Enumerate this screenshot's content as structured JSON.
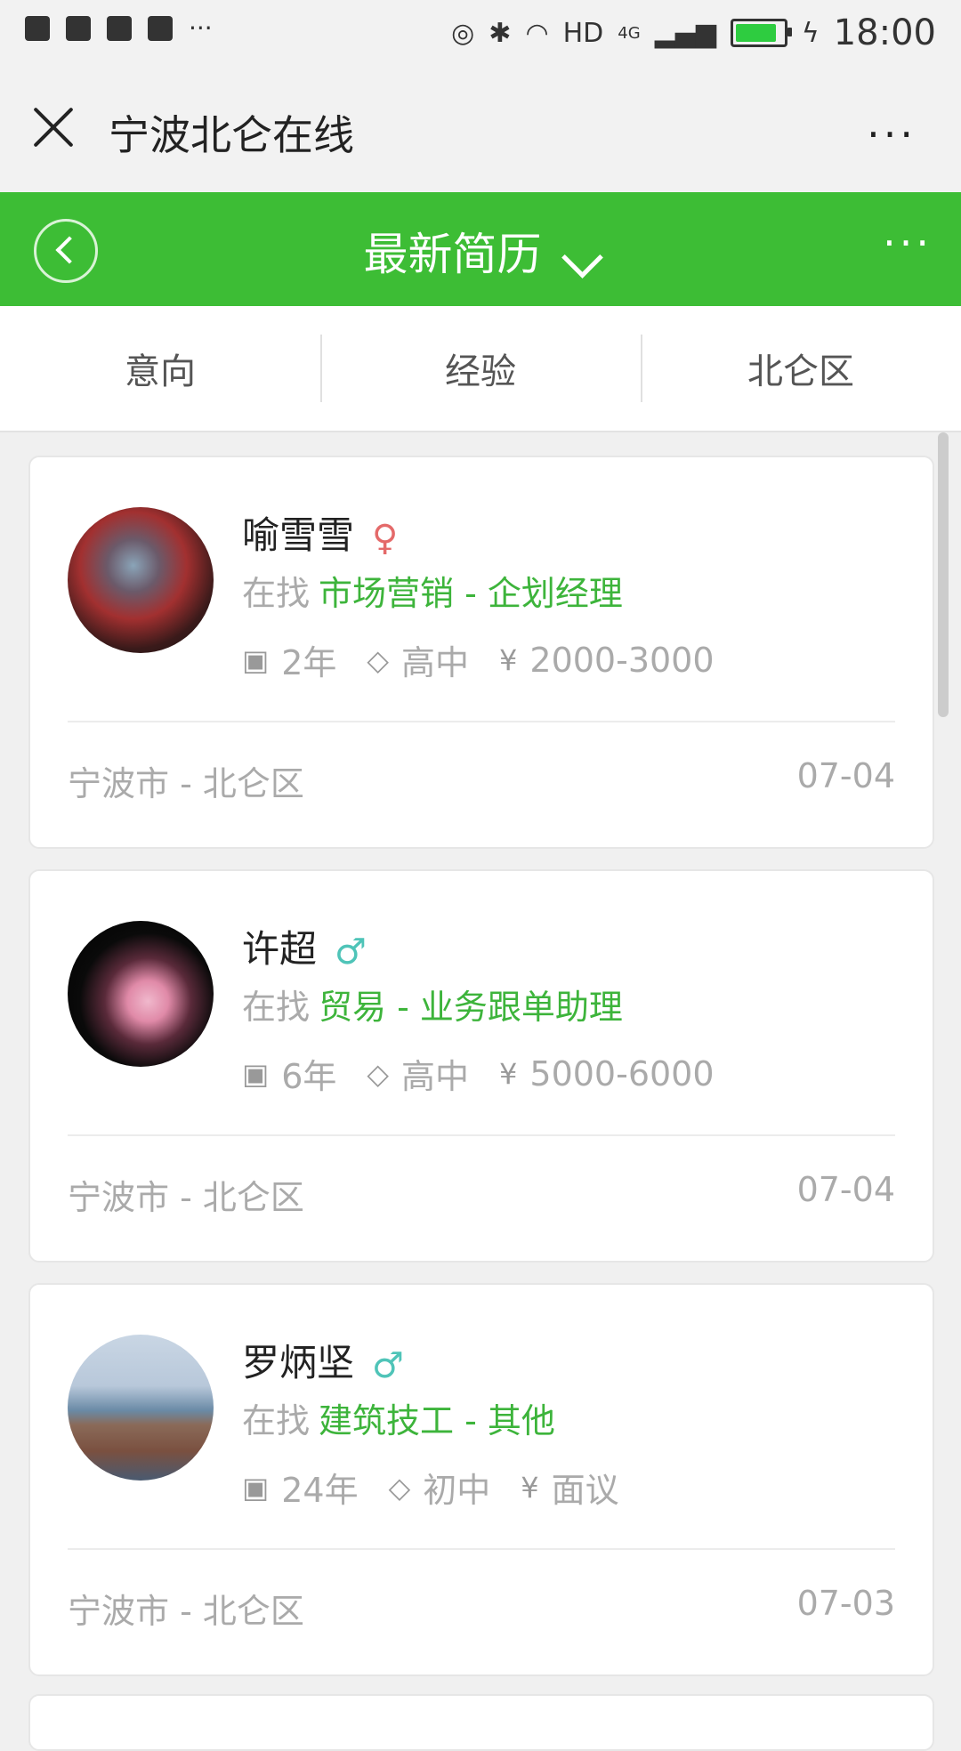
{
  "status_bar": {
    "network": "HD",
    "signal": "4G",
    "time": "18:00"
  },
  "titlebar": {
    "title": "宁波北仑在线",
    "more": "···"
  },
  "header": {
    "title": "最新简历",
    "more": "···"
  },
  "filters": [
    "意向",
    "经验",
    "北仑区"
  ],
  "colors": {
    "brand_green": "#3dbd35",
    "job_green": "#3db43b"
  },
  "resumes": [
    {
      "name": "喻雪雪",
      "gender": "female",
      "gender_symbol": "♀",
      "gender_color": "#e46a6a",
      "seek_label": "在找",
      "job": "市场营销 - 企划经理",
      "experience": "2年",
      "education": "高中",
      "currency": "¥",
      "salary": "2000-3000",
      "location": "宁波市 - 北仑区",
      "date": "07-04"
    },
    {
      "name": "许超",
      "gender": "male",
      "gender_symbol": "♂",
      "gender_color": "#4fc4b8",
      "seek_label": "在找",
      "job": "贸易 - 业务跟单助理",
      "experience": "6年",
      "education": "高中",
      "currency": "¥",
      "salary": "5000-6000",
      "location": "宁波市 - 北仑区",
      "date": "07-04"
    },
    {
      "name": "罗炳坚",
      "gender": "male",
      "gender_symbol": "♂",
      "gender_color": "#4fc4b8",
      "seek_label": "在找",
      "job": "建筑技工 - 其他",
      "experience": "24年",
      "education": "初中",
      "currency": "¥",
      "salary": "面议",
      "location": "宁波市 - 北仑区",
      "date": "07-03"
    }
  ]
}
